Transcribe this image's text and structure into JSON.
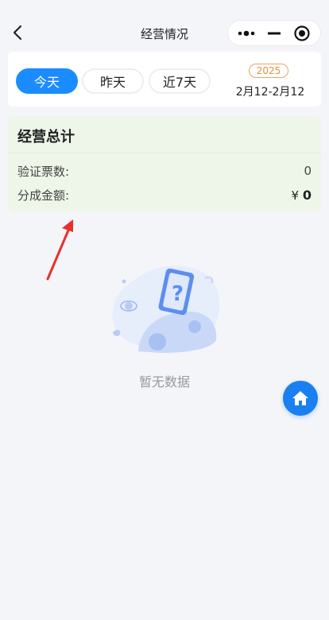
{
  "nav": {
    "title": "经营情况",
    "back_icon": "chevron-left-icon",
    "menu_icon": "more-dots-icon",
    "minimize_icon": "minus-icon",
    "close_icon": "target-circle-icon"
  },
  "filter": {
    "tabs": [
      {
        "label": "今天",
        "active": true
      },
      {
        "label": "昨天",
        "active": false
      },
      {
        "label": "近7天",
        "active": false
      }
    ],
    "year": "2025",
    "date_range": "2月12-2月12"
  },
  "summary": {
    "title": "经营总计",
    "rows": [
      {
        "label": "验证票数:",
        "value": "0"
      },
      {
        "label": "分成金额:",
        "currency": "¥",
        "value": "0"
      }
    ]
  },
  "empty": {
    "text": "暂无数据",
    "illustration_icon": "empty-phone-question-icon"
  },
  "fab": {
    "icon": "home-icon"
  },
  "colors": {
    "accent": "#1a8cff",
    "year_badge": "#e09040",
    "summary_bg": "#eef6e9",
    "page_bg": "#f4f5f9",
    "annotation_arrow": "#e8302a"
  }
}
